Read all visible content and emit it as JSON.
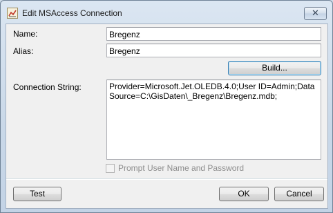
{
  "window": {
    "title": "Edit MSAccess Connection",
    "close_label": "✕"
  },
  "form": {
    "name_label": "Name:",
    "name_value": "Bregenz",
    "alias_label": "Alias:",
    "alias_value": "Bregenz",
    "build_label": "Build...",
    "connection_label": "Connection String:",
    "connection_value": "Provider=Microsoft.Jet.OLEDB.4.0;User ID=Admin;Data Source=C:\\GisDaten\\_Bregenz\\Bregenz.mdb;",
    "prompt_label": "Prompt User Name and Password",
    "prompt_checked": false
  },
  "footer": {
    "test_label": "Test",
    "ok_label": "OK",
    "cancel_label": "Cancel"
  }
}
